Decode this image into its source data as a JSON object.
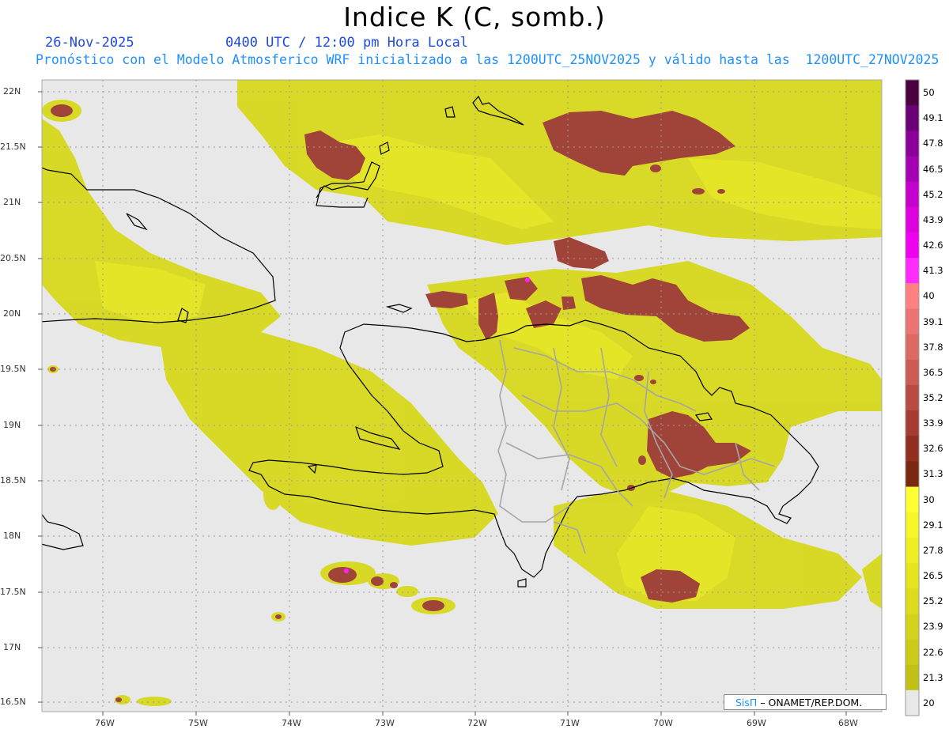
{
  "title": "Indice K (C, somb.)",
  "header": {
    "date": "26-Nov-2025",
    "valid_time": "0400 UTC / 12:00 pm Hora Local",
    "model_line": "Pronóstico con el Modelo Atmosferico WRF inicializado a las 1200UTC_25NOV2025 y válido hasta las  1200UTC_27NOV2025"
  },
  "map": {
    "lat_labels": [
      "22N",
      "21.5N",
      "21N",
      "20.5N",
      "20N",
      "19.5N",
      "19N",
      "18.5N",
      "18N",
      "17.5N",
      "17N",
      "16.5N"
    ],
    "lon_labels": [
      "76W",
      "75W",
      "74W",
      "73W",
      "72W",
      "71W",
      "70W",
      "69W",
      "68W"
    ],
    "background_color": "#e8e8e8"
  },
  "colorbar": {
    "labels": [
      "50",
      "49.1",
      "47.8",
      "46.5",
      "45.2",
      "43.9",
      "42.6",
      "41.3",
      "40",
      "39.1",
      "37.8",
      "36.5",
      "35.2",
      "33.9",
      "32.6",
      "31.3",
      "30",
      "29.1",
      "27.8",
      "26.5",
      "25.2",
      "23.9",
      "22.6",
      "21.3",
      "20"
    ],
    "colors": [
      "#4b0040",
      "#6a0075",
      "#8a0099",
      "#a400b4",
      "#c400cc",
      "#dd00dd",
      "#f000f0",
      "#ff2bff",
      "#ff8080",
      "#ed7474",
      "#dd6a62",
      "#cc5b55",
      "#b94b42",
      "#a63b33",
      "#913020",
      "#7a2810",
      "#ffff33",
      "#f7f727",
      "#eeee22",
      "#e5e51e",
      "#dcdc1c",
      "#d3d31c",
      "#cbcb18",
      "#c2c216",
      "#e8e8e8"
    ]
  },
  "credit": {
    "logo": "SisΠ",
    "text": " – ONAMET/REP.DOM."
  }
}
